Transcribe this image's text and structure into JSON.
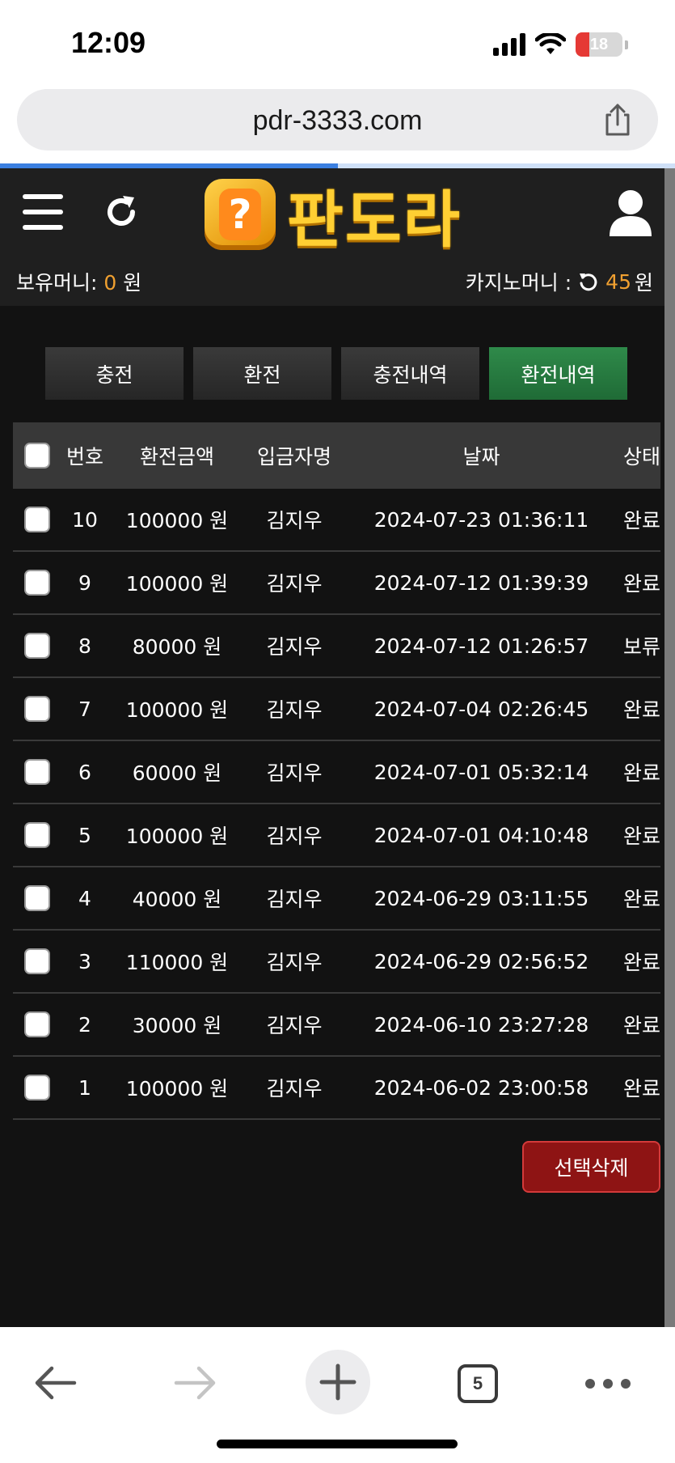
{
  "status_bar": {
    "time": "12:09",
    "battery": "18",
    "icons": [
      "signal-icon",
      "wifi-icon",
      "battery-charging-icon"
    ]
  },
  "browser": {
    "url": "pdr-3333.com",
    "load_progress": 0.5,
    "open_tabs": "5",
    "icons": [
      "share-icon",
      "back-arrow-icon",
      "forward-arrow-icon",
      "plus-icon",
      "more-dots-icon"
    ]
  },
  "site": {
    "logo_text": "판도라",
    "wallet": {
      "label": "보유머니:",
      "value": "0",
      "unit": "원"
    },
    "casino": {
      "label": "카지노머니 :",
      "value": "45",
      "unit": "원"
    },
    "tabs": [
      {
        "label": "충전",
        "active": false
      },
      {
        "label": "환전",
        "active": false
      },
      {
        "label": "충전내역",
        "active": false
      },
      {
        "label": "환전내역",
        "active": true
      }
    ],
    "table": {
      "headers": {
        "no": "번호",
        "amount": "환전금액",
        "name": "입금자명",
        "date": "날짜",
        "status": "상태"
      },
      "rows": [
        {
          "no": "10",
          "amount": "100000 원",
          "name": "김지우",
          "date": "2024-07-23 01:36:11",
          "status": "완료"
        },
        {
          "no": "9",
          "amount": "100000 원",
          "name": "김지우",
          "date": "2024-07-12 01:39:39",
          "status": "완료"
        },
        {
          "no": "8",
          "amount": "80000 원",
          "name": "김지우",
          "date": "2024-07-12 01:26:57",
          "status": "보류"
        },
        {
          "no": "7",
          "amount": "100000 원",
          "name": "김지우",
          "date": "2024-07-04 02:26:45",
          "status": "완료"
        },
        {
          "no": "6",
          "amount": "60000 원",
          "name": "김지우",
          "date": "2024-07-01 05:32:14",
          "status": "완료"
        },
        {
          "no": "5",
          "amount": "100000 원",
          "name": "김지우",
          "date": "2024-07-01 04:10:48",
          "status": "완료"
        },
        {
          "no": "4",
          "amount": "40000 원",
          "name": "김지우",
          "date": "2024-06-29 03:11:55",
          "status": "완료"
        },
        {
          "no": "3",
          "amount": "110000 원",
          "name": "김지우",
          "date": "2024-06-29 02:56:52",
          "status": "완료"
        },
        {
          "no": "2",
          "amount": "30000 원",
          "name": "김지우",
          "date": "2024-06-10 23:27:28",
          "status": "완료"
        },
        {
          "no": "1",
          "amount": "100000 원",
          "name": "김지우",
          "date": "2024-06-02 23:00:58",
          "status": "완료"
        }
      ]
    },
    "delete_button": "선택삭제",
    "colors": {
      "background": "#121212",
      "header": "#1f1f1f",
      "accent_orange": "#f0a030",
      "active_tab": "#2f8a4a",
      "delete_red": "#8e1414"
    }
  }
}
